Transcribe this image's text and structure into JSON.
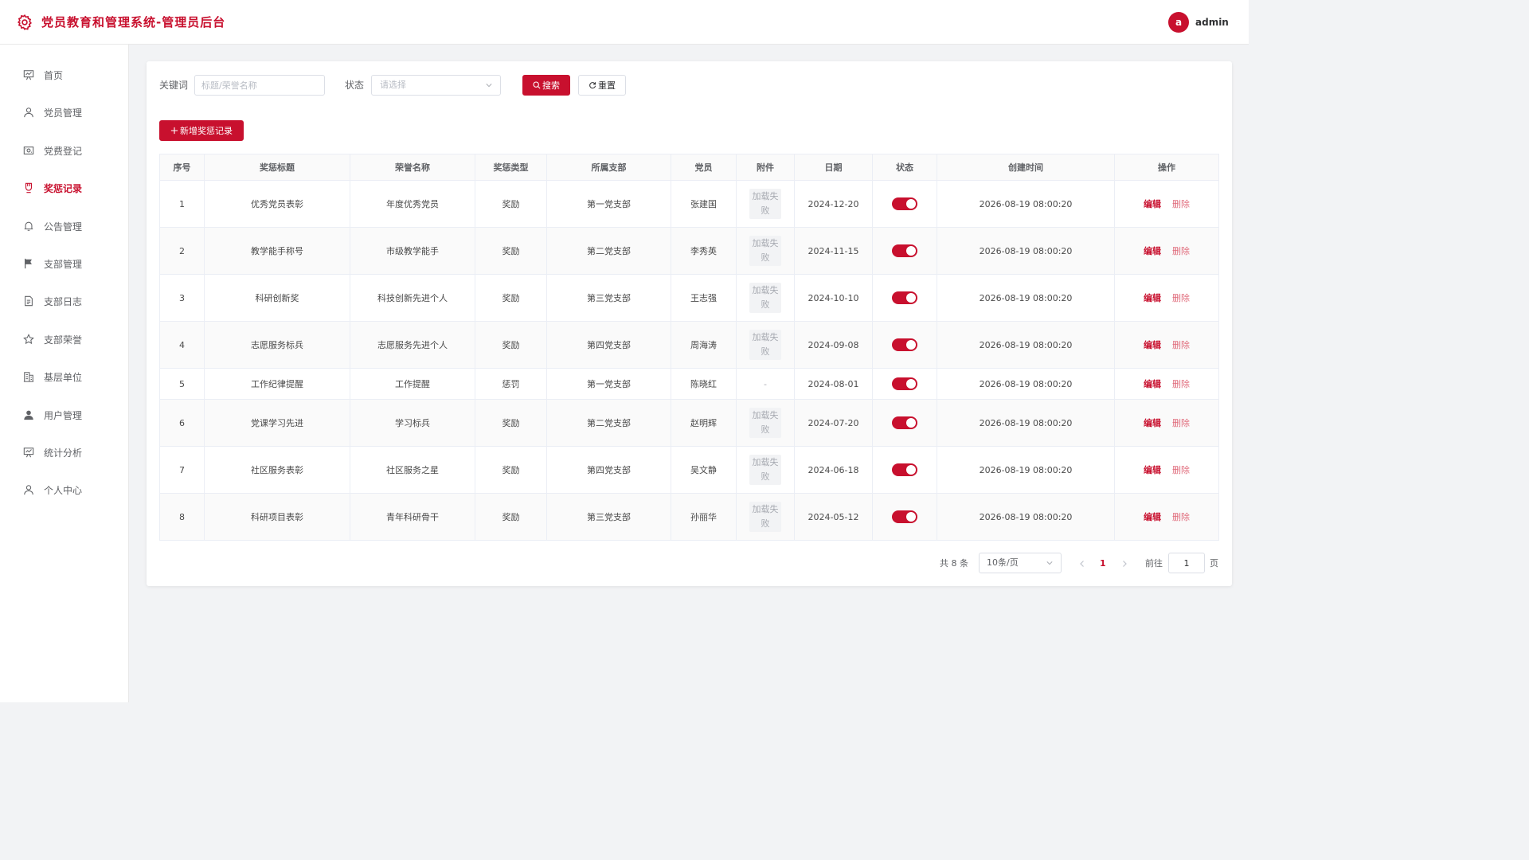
{
  "header": {
    "title": "党员教育和管理系统-管理员后台",
    "user_initial": "a",
    "username": "admin"
  },
  "colors": {
    "brand": "#c8102e"
  },
  "sidebar": {
    "items": [
      {
        "label": "首页",
        "icon": "chart-board-icon"
      },
      {
        "label": "党员管理",
        "icon": "user-icon"
      },
      {
        "label": "党费登记",
        "icon": "money-icon"
      },
      {
        "label": "奖惩记录",
        "icon": "medal-icon",
        "active": true
      },
      {
        "label": "公告管理",
        "icon": "bell-icon"
      },
      {
        "label": "支部管理",
        "icon": "flag-icon"
      },
      {
        "label": "支部日志",
        "icon": "document-icon"
      },
      {
        "label": "支部荣誉",
        "icon": "star-icon"
      },
      {
        "label": "基层单位",
        "icon": "building-icon"
      },
      {
        "label": "用户管理",
        "icon": "user-filled-icon"
      },
      {
        "label": "统计分析",
        "icon": "chart-board-icon"
      },
      {
        "label": "个人中心",
        "icon": "user-icon"
      }
    ]
  },
  "filters": {
    "keyword_label": "关键词",
    "keyword_placeholder": "标题/荣誉名称",
    "status_label": "状态",
    "status_placeholder": "请选择",
    "search_label": "搜索",
    "reset_label": "重置"
  },
  "add_button_label": "新增奖惩记录",
  "table": {
    "columns": [
      "序号",
      "奖惩标题",
      "荣誉名称",
      "奖惩类型",
      "所属支部",
      "党员",
      "附件",
      "日期",
      "状态",
      "创建时间",
      "操作"
    ],
    "attach_failed": "加载失败",
    "attach_none": "-",
    "edit_label": "编辑",
    "delete_label": "删除",
    "rows": [
      {
        "no": "1",
        "title": "优秀党员表彰",
        "honor": "年度优秀党员",
        "type": "奖励",
        "branch": "第一党支部",
        "member": "张建国",
        "attach": "failed",
        "date": "2024-12-20",
        "status": true,
        "created": "2026-08-19 08:00:20"
      },
      {
        "no": "2",
        "title": "教学能手称号",
        "honor": "市级教学能手",
        "type": "奖励",
        "branch": "第二党支部",
        "member": "李秀英",
        "attach": "failed",
        "date": "2024-11-15",
        "status": true,
        "created": "2026-08-19 08:00:20"
      },
      {
        "no": "3",
        "title": "科研创新奖",
        "honor": "科技创新先进个人",
        "type": "奖励",
        "branch": "第三党支部",
        "member": "王志强",
        "attach": "failed",
        "date": "2024-10-10",
        "status": true,
        "created": "2026-08-19 08:00:20"
      },
      {
        "no": "4",
        "title": "志愿服务标兵",
        "honor": "志愿服务先进个人",
        "type": "奖励",
        "branch": "第四党支部",
        "member": "周海涛",
        "attach": "failed",
        "date": "2024-09-08",
        "status": true,
        "created": "2026-08-19 08:00:20"
      },
      {
        "no": "5",
        "title": "工作纪律提醒",
        "honor": "工作提醒",
        "type": "惩罚",
        "branch": "第一党支部",
        "member": "陈晓红",
        "attach": "none",
        "date": "2024-08-01",
        "status": true,
        "created": "2026-08-19 08:00:20"
      },
      {
        "no": "6",
        "title": "党课学习先进",
        "honor": "学习标兵",
        "type": "奖励",
        "branch": "第二党支部",
        "member": "赵明辉",
        "attach": "failed",
        "date": "2024-07-20",
        "status": true,
        "created": "2026-08-19 08:00:20"
      },
      {
        "no": "7",
        "title": "社区服务表彰",
        "honor": "社区服务之星",
        "type": "奖励",
        "branch": "第四党支部",
        "member": "吴文静",
        "attach": "failed",
        "date": "2024-06-18",
        "status": true,
        "created": "2026-08-19 08:00:20"
      },
      {
        "no": "8",
        "title": "科研项目表彰",
        "honor": "青年科研骨干",
        "type": "奖励",
        "branch": "第三党支部",
        "member": "孙丽华",
        "attach": "failed",
        "date": "2024-05-12",
        "status": true,
        "created": "2026-08-19 08:00:20"
      }
    ]
  },
  "pagination": {
    "total_text": "共 8 条",
    "page_size": "10条/页",
    "current_page": "1",
    "goto_label": "前往",
    "goto_value": "1",
    "page_suffix": "页"
  }
}
